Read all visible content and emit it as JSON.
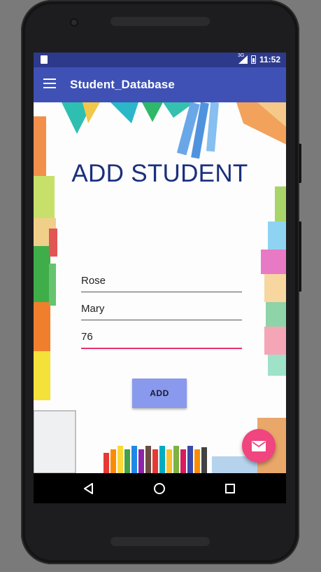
{
  "statusbar": {
    "network": "3G",
    "time": "11:52"
  },
  "appbar": {
    "title": "Student_Database",
    "menu_icon": "hamburger-menu-icon"
  },
  "main": {
    "heading": "ADD STUDENT",
    "fields": [
      {
        "value": "Rose",
        "active": false
      },
      {
        "value": "Mary",
        "active": false
      },
      {
        "value": "76",
        "active": true
      }
    ],
    "add_button_label": "ADD"
  },
  "fab": {
    "icon": "mail-icon",
    "color": "#f0457f"
  },
  "navbar": {
    "back_icon": "back-triangle-icon",
    "home_icon": "home-circle-icon",
    "recents_icon": "recents-square-icon"
  },
  "colors": {
    "primary": "#3f51b5",
    "status_bar": "#2d3a8c",
    "accent": "#e6336c",
    "heading": "#1a2f7d",
    "button": "#8899ee"
  }
}
